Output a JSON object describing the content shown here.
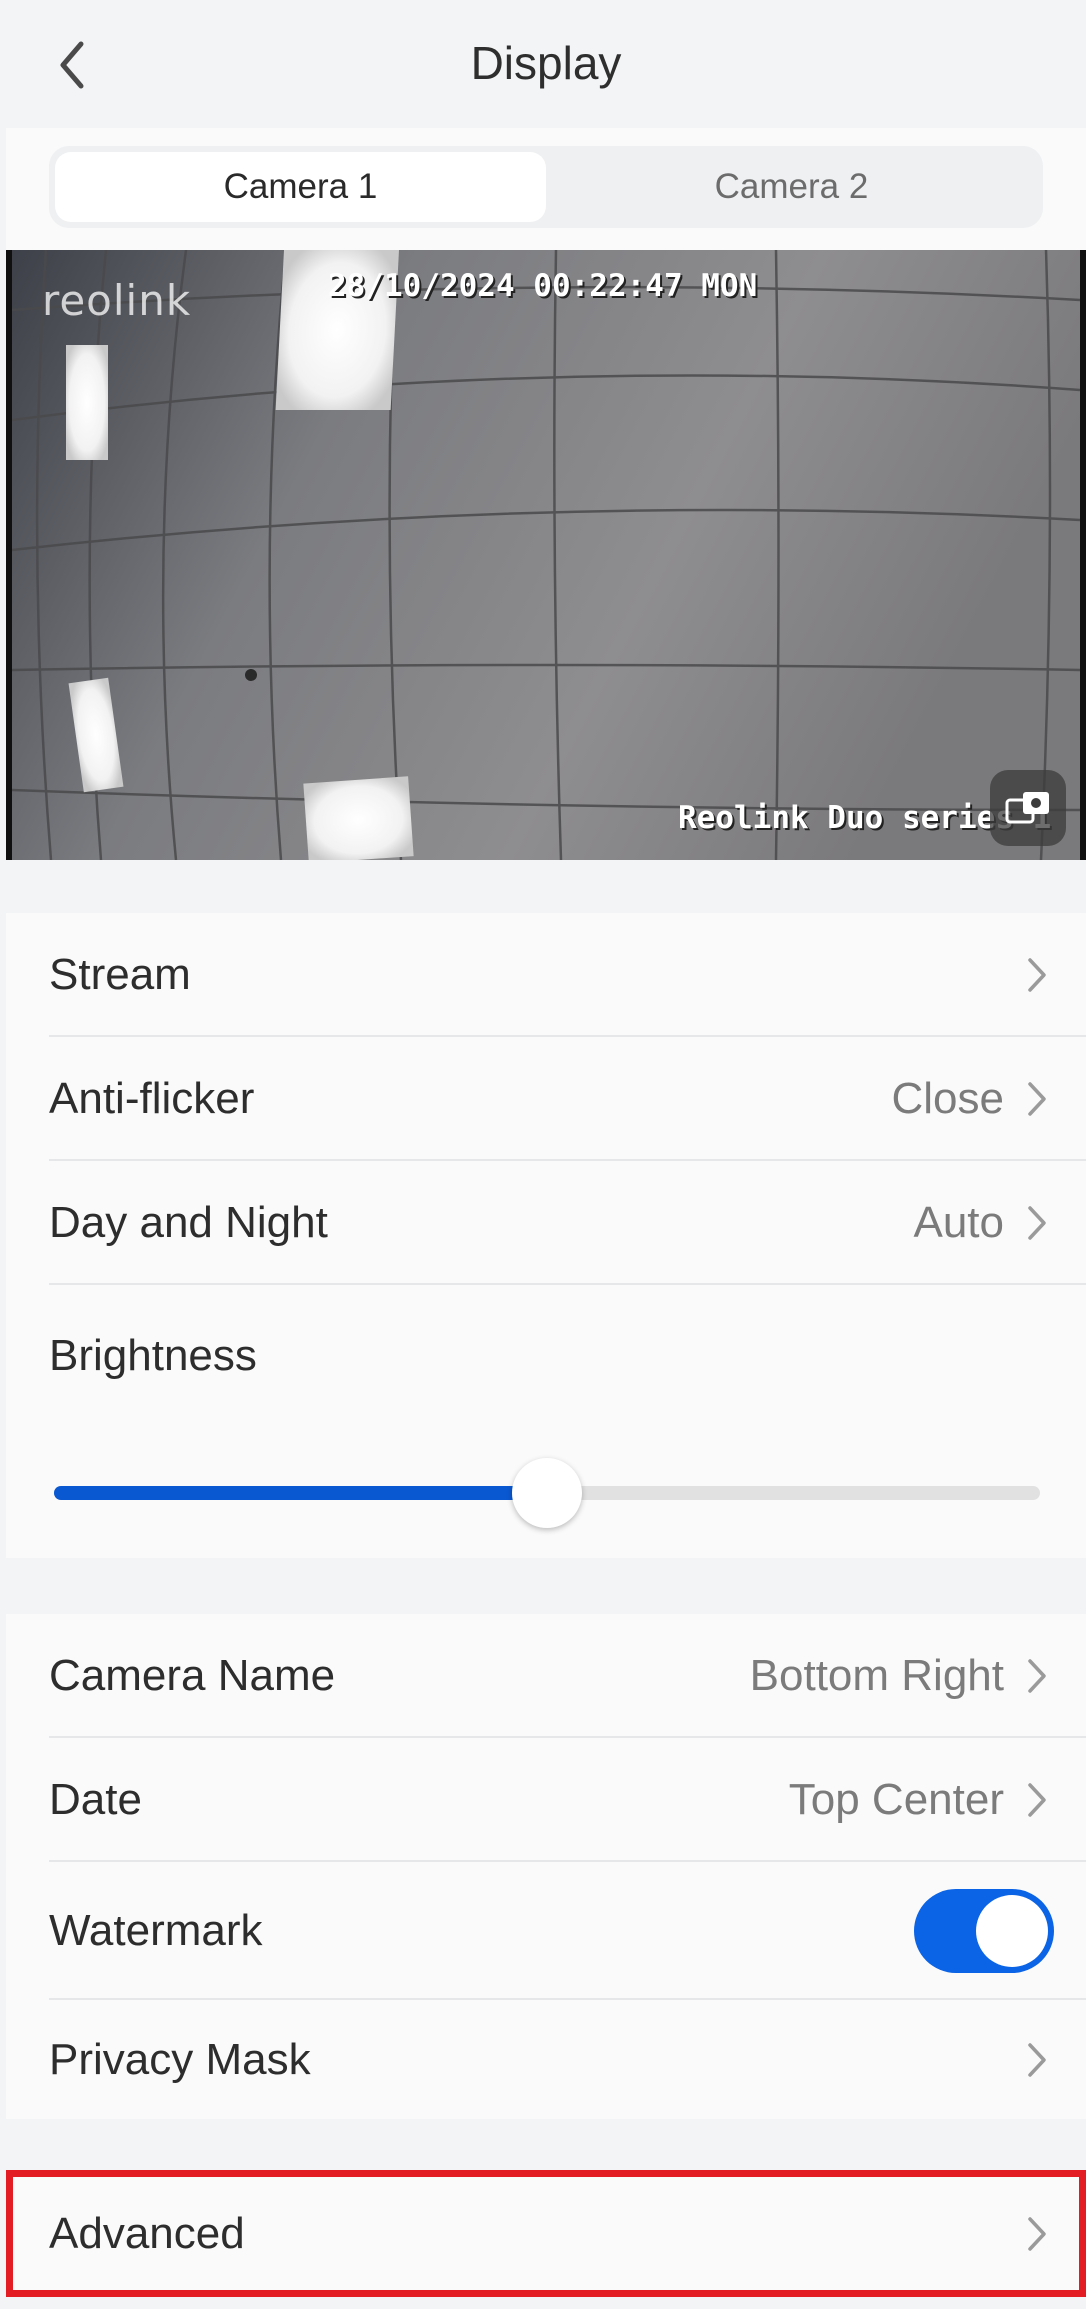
{
  "header": {
    "title": "Display"
  },
  "tabs": [
    {
      "label": "Camera 1",
      "active": true
    },
    {
      "label": "Camera 2",
      "active": false
    }
  ],
  "preview": {
    "logo": "reolink",
    "timestamp": "28/10/2024 00:22:47 MON",
    "camera_name": "Reolink Duo series 1"
  },
  "section1": {
    "stream_label": "Stream",
    "antiflicker_label": "Anti-flicker",
    "antiflicker_value": "Close",
    "daynight_label": "Day and Night",
    "daynight_value": "Auto",
    "brightness_label": "Brightness",
    "brightness_level": 0.5
  },
  "section2": {
    "camera_name_label": "Camera Name",
    "camera_name_value": "Bottom Right",
    "date_label": "Date",
    "date_value": "Top Center",
    "watermark_label": "Watermark",
    "watermark_on": true,
    "privacy_label": "Privacy Mask"
  },
  "advanced": {
    "label": "Advanced"
  },
  "colors": {
    "accent": "#0b63e5",
    "slider_fill": "#0a58d1",
    "highlight": "#e21c22",
    "background": "#f3f4f6"
  }
}
